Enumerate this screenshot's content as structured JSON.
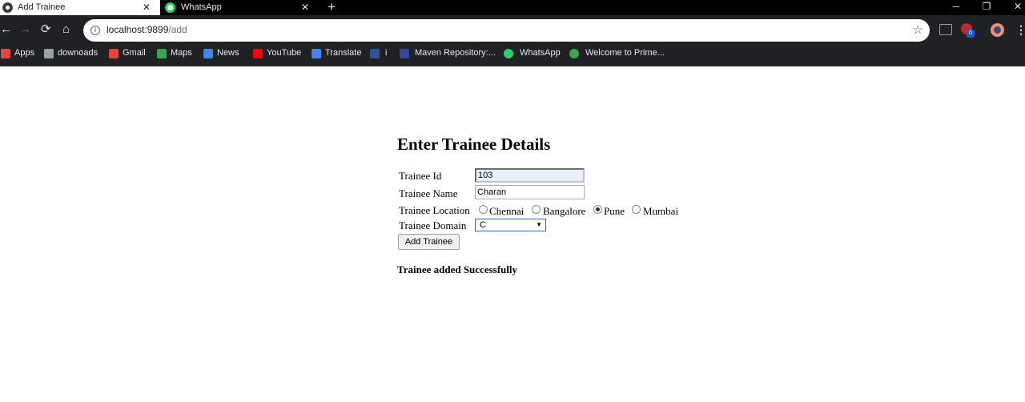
{
  "browser": {
    "tabs": [
      {
        "title": "Add Trainee",
        "icon": "globe-icon",
        "active": true
      },
      {
        "title": "WhatsApp",
        "icon": "whatsapp-icon",
        "active": false
      }
    ],
    "close_glyph": "✕",
    "new_tab_glyph": "+",
    "window_controls": {
      "minimize": "─",
      "restore": "❐",
      "close": "✕"
    },
    "nav": {
      "back": "←",
      "forward": "→",
      "reload": "⟳",
      "home": "⌂"
    },
    "address": {
      "host": "localhost:9899",
      "path": "/add",
      "info_glyph": "i",
      "star_glyph": "☆"
    },
    "extension_badge": "0",
    "menu_glyph": "⋮",
    "bookmarks": [
      {
        "label": "Apps",
        "icon": "apps-grid-icon",
        "color": "#e8453c"
      },
      {
        "label": "downoads",
        "icon": "history-icon",
        "color": "#9aa0a6"
      },
      {
        "label": "Gmail",
        "icon": "gmail-icon",
        "color": "#ea4335"
      },
      {
        "label": "Maps",
        "icon": "maps-icon",
        "color": "#34a853"
      },
      {
        "label": "News",
        "icon": "news-icon",
        "color": "#4285f4"
      },
      {
        "label": "YouTube",
        "icon": "youtube-icon",
        "color": "#ff0000"
      },
      {
        "label": "Translate",
        "icon": "translate-icon",
        "color": "#4285f4"
      },
      {
        "label": "i",
        "icon": "word-icon",
        "color": "#2b579a"
      },
      {
        "label": "Maven Repository:...",
        "icon": "maven-icon",
        "color": "#2f4a9a"
      },
      {
        "label": "WhatsApp",
        "icon": "whatsapp-icon",
        "color": "#25d366"
      },
      {
        "label": "Welcome to Prime...",
        "icon": "prime-icon",
        "color": "#34a853"
      }
    ]
  },
  "form": {
    "heading": "Enter Trainee Details",
    "id_label": "Trainee Id",
    "id_value": "103",
    "name_label": "Trainee Name",
    "name_value": "Charan",
    "location_label": "Trainee Location",
    "locations": [
      {
        "label": "Chennai",
        "checked": false
      },
      {
        "label": "Bangalore",
        "checked": false
      },
      {
        "label": "Pune",
        "checked": true
      },
      {
        "label": "Mumbai",
        "checked": false
      }
    ],
    "domain_label": "Trainee Domain",
    "domain_value": "C",
    "submit_label": "Add Trainee",
    "status_message": "Trainee added Successfully"
  }
}
